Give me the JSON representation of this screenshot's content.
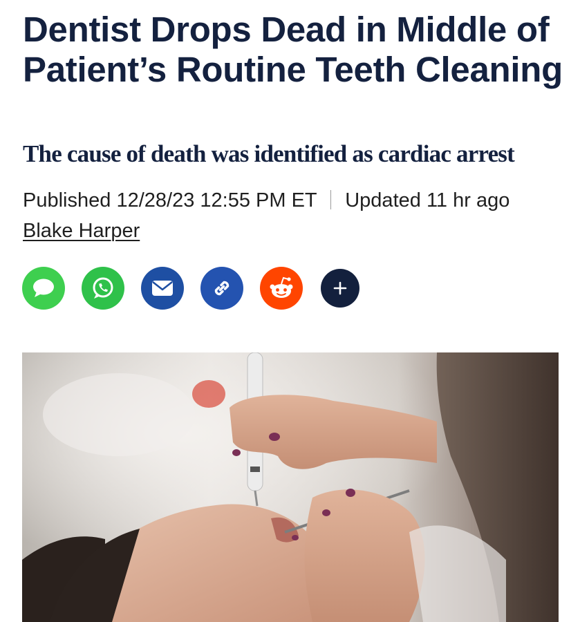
{
  "article": {
    "headline": "Dentist Drops Dead in Middle of Patient’s Routine Teeth Cleaning",
    "subheadline": "The cause of death was identified as cardiac arrest",
    "published_label": "Published",
    "published_datetime": "12/28/23 12:55 PM ET",
    "updated_label": "Updated",
    "updated_ago": "11 hr ago",
    "author": "Blake Harper"
  },
  "share": {
    "buttons": [
      {
        "name": "message",
        "icon": "speech-bubble-icon",
        "color": "#3ecf4f"
      },
      {
        "name": "whatsapp",
        "icon": "whatsapp-icon",
        "color": "#2fc14a"
      },
      {
        "name": "email",
        "icon": "envelope-icon",
        "color": "#1e4fa3"
      },
      {
        "name": "copy-link",
        "icon": "link-icon",
        "color": "#2453b0"
      },
      {
        "name": "reddit",
        "icon": "reddit-icon",
        "color": "#ff4500"
      },
      {
        "name": "more",
        "icon": "plus-icon",
        "color": "#13203d"
      }
    ]
  },
  "hero_image": {
    "subject": "dentist cleaning patient's teeth"
  }
}
